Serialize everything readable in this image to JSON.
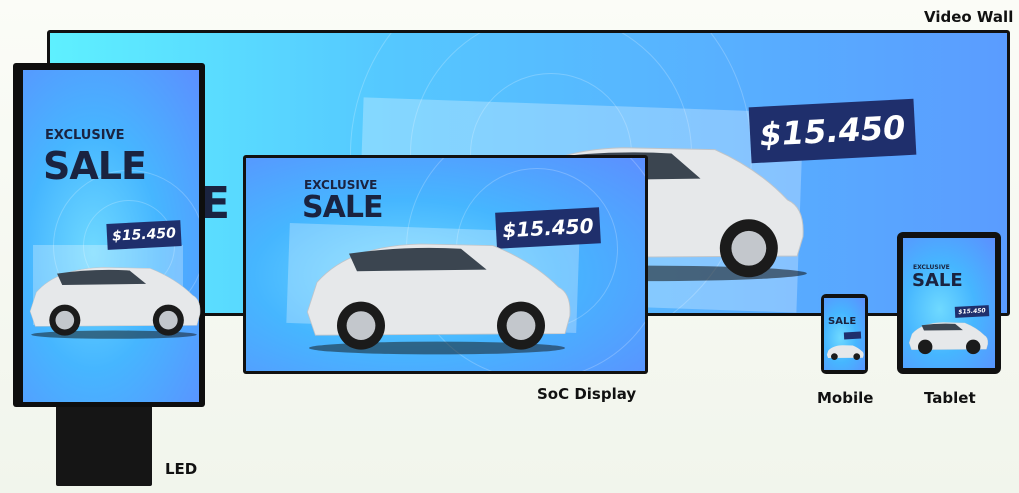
{
  "devices": {
    "video_wall": {
      "label": "Video Wall",
      "price": "$15.450"
    },
    "led": {
      "label": "LED",
      "exclusive": "EXCLUSIVE",
      "sale": "SALE",
      "price": "$15.450"
    },
    "soc": {
      "label": "SoC Display",
      "exclusive": "EXCLUSIVE",
      "sale": "SALE",
      "price": "$15.450"
    },
    "mobile": {
      "label": "Mobile",
      "sale": "SALE"
    },
    "tablet": {
      "label": "Tablet",
      "exclusive": "EXCLUSIVE",
      "sale": "SALE",
      "price": "$15.450"
    }
  },
  "colors": {
    "screen_light": "#6fd9ff",
    "screen_dark": "#5c8fff",
    "price_tag": "#1f2f6c",
    "heading": "#1a2340"
  },
  "icons": {
    "car": "suv-car-image"
  }
}
